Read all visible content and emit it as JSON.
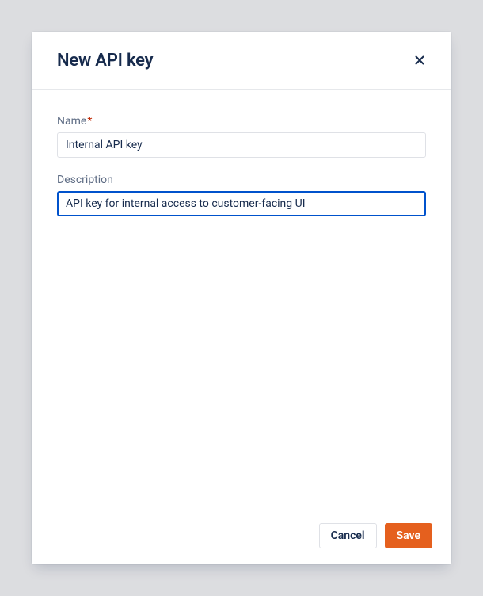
{
  "dialog": {
    "title": "New API key",
    "fields": {
      "name": {
        "label": "Name",
        "required": true,
        "value": "Internal API key"
      },
      "description": {
        "label": "Description",
        "required": false,
        "value": "API key for internal access to customer-facing UI"
      }
    },
    "buttons": {
      "cancel": "Cancel",
      "save": "Save"
    }
  },
  "colors": {
    "accent": "#e5601e",
    "text_primary": "#172b4d",
    "text_secondary": "#5e6c84",
    "focus_border": "#0052cc",
    "required": "#bf2600"
  }
}
